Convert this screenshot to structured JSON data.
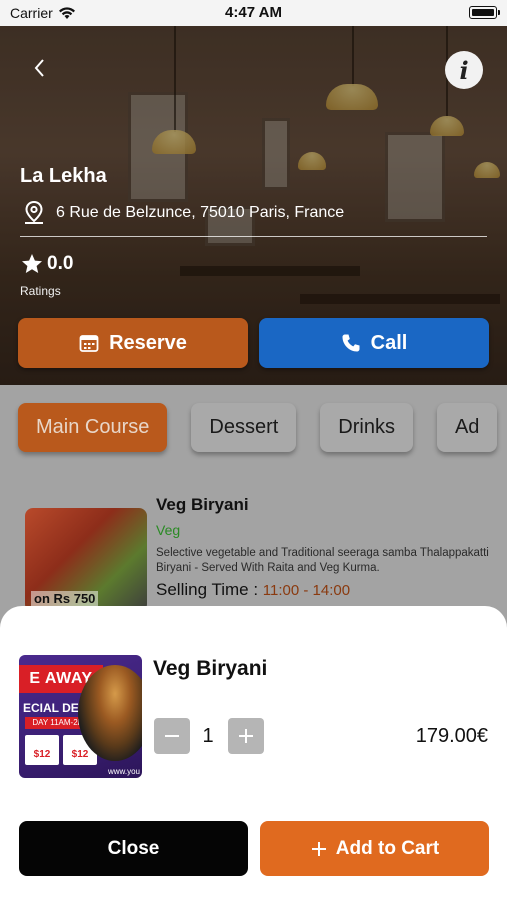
{
  "status_bar": {
    "carrier": "Carrier",
    "time": "4:47 AM"
  },
  "restaurant": {
    "name": "La Lekha",
    "address": "6 Rue de Belzunce, 75010 Paris, France",
    "rating": "0.0",
    "ratings_label": "Ratings"
  },
  "actions": {
    "reserve_label": "Reserve",
    "call_label": "Call"
  },
  "categories": [
    "Main Course",
    "Dessert",
    "Drinks",
    "Ad"
  ],
  "menu_item": {
    "title": "Veg Biryani",
    "type": "Veg",
    "description": "Selective vegetable and Traditional seeraga samba Thalappakatti Biryani - Served With Raita and Veg Kurma.",
    "selling_time_label": "Selling Time :",
    "selling_time": "11:00 - 14:00",
    "thumb_text": "on Rs 750"
  },
  "sheet": {
    "title": "Veg Biryani",
    "quantity": "1",
    "price": "179.00€",
    "close_label": "Close",
    "add_label": "Add to Cart",
    "thumb_banner": "E AWAY",
    "thumb_deal": "ECIAL DEAL",
    "thumb_deal_time": "DAY 11AM-2PM",
    "thumb_price_1": "$12",
    "thumb_price_2": "$12",
    "thumb_url": "www.you"
  },
  "colors": {
    "accent": "#b9591c",
    "call": "#1a67c4",
    "add_to_cart": "#e06a1f",
    "veg": "#2a8a24"
  }
}
